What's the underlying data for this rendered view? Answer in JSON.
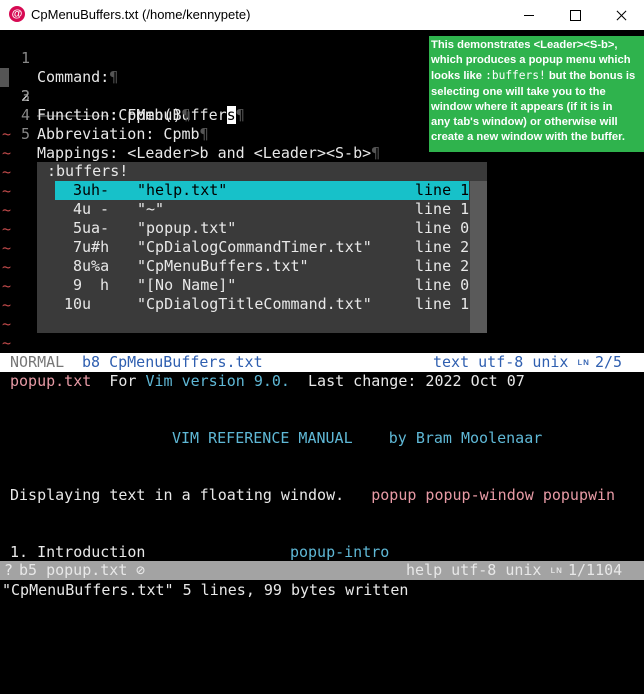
{
  "window": {
    "title": "CpMenuBuffers.txt (/home/kennypete)",
    "app_icon": "debian-swirl-icon"
  },
  "editor": {
    "lines": [
      {
        "num": "1",
        "text": "Command:",
        "eol": "¶"
      },
      {
        "num": "2",
        "indent": "———————→",
        "text_before_cursor": ":CpMenuBuffer",
        "cursor_char": "s",
        "eol": "¶"
      },
      {
        "num": "3",
        "text": "Function: Fpmb()",
        "eol": "¶"
      },
      {
        "num": "4",
        "text": "Abbreviation: Cpmb",
        "eol": "¶"
      },
      {
        "num": "5",
        "text": "Mappings: <Leader>b and <Leader><S-b>",
        "eol": "¶"
      }
    ],
    "tilde": "~"
  },
  "note_popup": {
    "line1": "This demonstrates <Leader><S-b>,",
    "line2": "which produces a popup menu which",
    "line3a": "looks like ",
    "line3code": ":buffers!",
    "line3b": " but the bonus is",
    "line4": "selecting one will take you to the",
    "line5": "window where it appears (if it is in",
    "line6": "any tab's window) or otherwise will",
    "line7": "create a new window with the buffer."
  },
  "buffers_popup": {
    "title": ":buffers!",
    "rows": [
      {
        "num": "3u",
        "flags": "h-",
        "name": "\"help.txt\"",
        "line": "line 1",
        "selected": true
      },
      {
        "num": "4u",
        "flags": " -",
        "name": "\"~\"",
        "line": "line 1",
        "selected": false
      },
      {
        "num": "5u",
        "flags": "a-",
        "name": "\"popup.txt\"",
        "line": "line 0",
        "selected": false
      },
      {
        "num": "7u#h",
        "flags": "",
        "name": "\"CpDialogCommandTimer.txt\"",
        "line": "line 2",
        "selected": false
      },
      {
        "num": "8u%a",
        "flags": "",
        "name": "\"CpMenuBuffers.txt\"",
        "line": "line 2",
        "selected": false
      },
      {
        "num": "9",
        "flags": " h",
        "name": "\"[No Name]\"",
        "line": "line 0",
        "selected": false
      },
      {
        "num": "10u",
        "flags": "",
        "name": "\"CpDialogTitleCommand.txt\"",
        "line": "line 1",
        "selected": false
      }
    ]
  },
  "status_top": {
    "mode": "NORMAL",
    "buffer": "b8 CpMenuBuffers.txt",
    "info": "text utf-8 unix",
    "ln_glyph": "ʟɴ",
    "pos": "2/5"
  },
  "help": {
    "header_file": "popup.txt",
    "header_for": "For",
    "header_vim": "Vim version 9.0.",
    "header_change": "Last change: 2022 Oct 07",
    "manual": "VIM REFERENCE MANUAL",
    "author": "by Bram Moolenaar",
    "desc": "Displaying text in a floating window.",
    "tags": "popup popup-window popupwin",
    "section": "1. Introduction",
    "section_tag": "popup-intro"
  },
  "status_bottom": {
    "prefix": "?",
    "buffer": "b5 popup.txt",
    "readonly": "⊘",
    "info": "help utf-8 unix",
    "ln_glyph": "ʟɴ",
    "pos": "1/1104"
  },
  "cmdline": "\"CpMenuBuffers.txt\" 5 lines, 99 bytes written",
  "colors": {
    "popup_green": "#2fb34d",
    "menu_selected": "#17c1c9",
    "tag_pink": "#e79aa5",
    "status_blue": "#2f5fb0"
  }
}
